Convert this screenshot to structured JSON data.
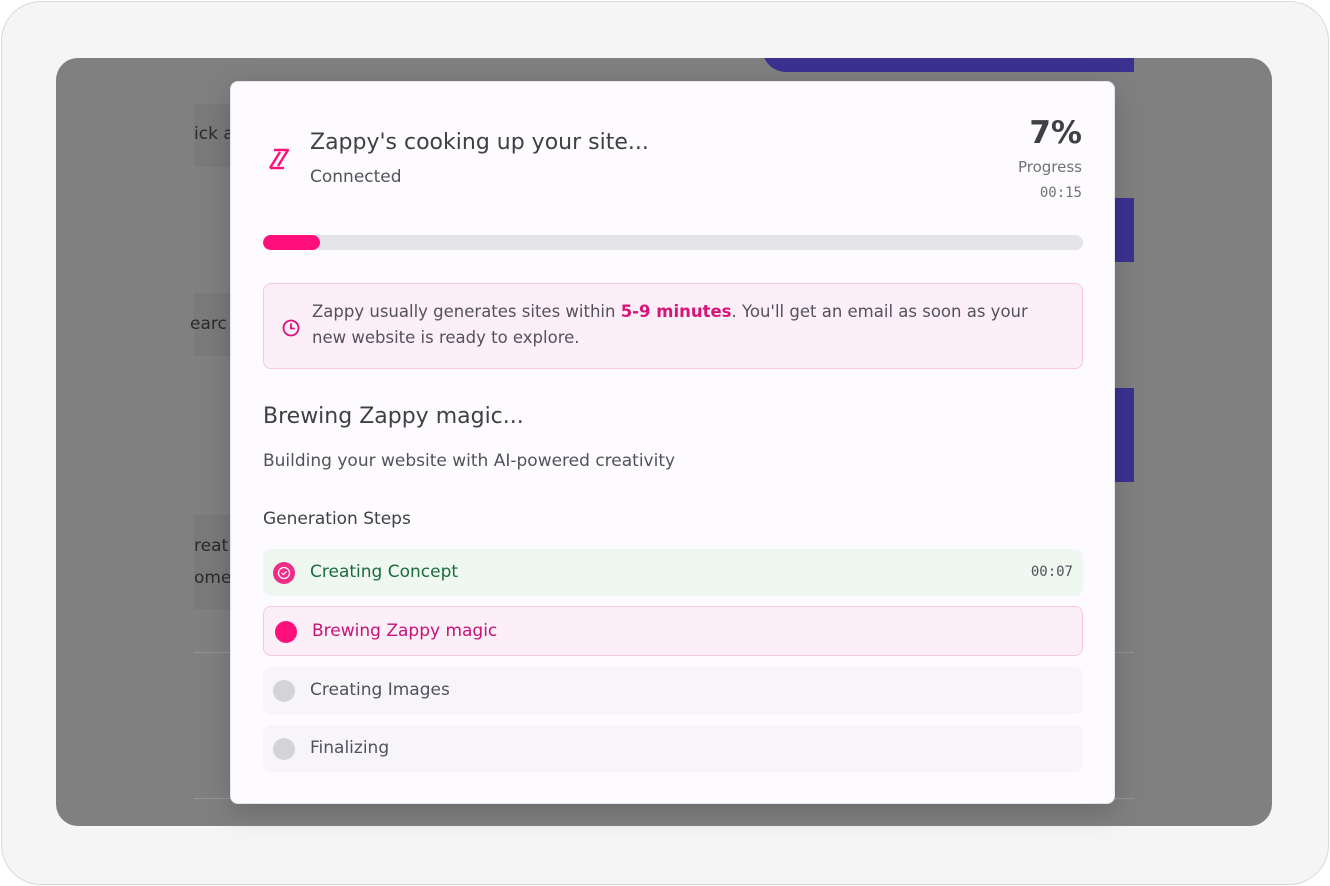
{
  "modal": {
    "title": "Zappy's cooking up your site...",
    "status": "Connected",
    "progress_value": "7%",
    "progress_label": "Progress",
    "elapsed": "00:15",
    "progress_fraction": 0.07,
    "logo_icon": "zappy-bolt-logo-icon",
    "accent_color": "#ff0f7b"
  },
  "info": {
    "icon": "clock-icon",
    "text_before": "Zappy usually generates sites within ",
    "highlight": "5-9 minutes",
    "text_after": ". You'll get an email as soon as your new website is ready to explore."
  },
  "stage": {
    "title": "Brewing Zappy magic...",
    "description": "Building your website with AI-powered creativity"
  },
  "steps": {
    "heading": "Generation Steps",
    "items": [
      {
        "label": "Creating Concept",
        "state": "done",
        "time": "00:07",
        "icon": "check-circle-icon"
      },
      {
        "label": "Brewing Zappy magic",
        "state": "active",
        "time": "",
        "icon": "active-dot-icon"
      },
      {
        "label": "Creating Images",
        "state": "pending",
        "time": "",
        "icon": "pending-dot-icon"
      },
      {
        "label": "Finalizing",
        "state": "pending",
        "time": "",
        "icon": "pending-dot-icon"
      }
    ]
  },
  "background": {
    "fragment_1": "ick a",
    "fragment_2": "earc",
    "fragment_3": "reat",
    "fragment_4": "ome"
  }
}
